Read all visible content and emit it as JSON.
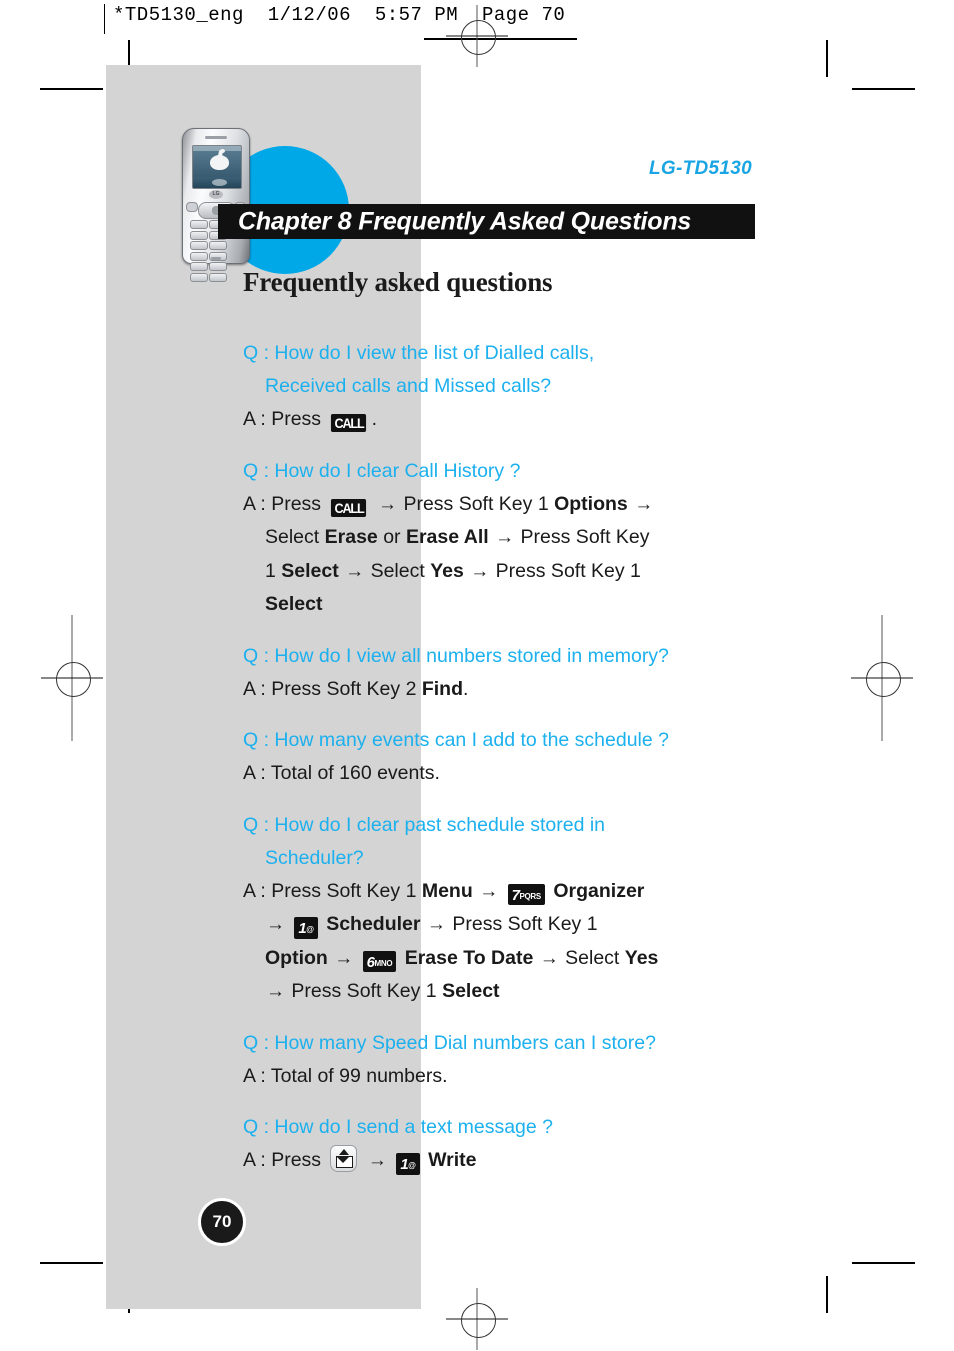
{
  "print_header": {
    "text": "*TD5130_eng  1/12/06  5:57 PM  Page 70"
  },
  "header": {
    "model": "LG-TD5130",
    "chapter_banner": "Chapter 8 Frequently Asked Questions",
    "page_title": "Frequently asked questions"
  },
  "colors": {
    "accent_blue": "#1cb0ee",
    "model_blue": "#19a5e3",
    "wave_blue": "#00a8e8",
    "banner_black": "#111111",
    "panel_gray": "#d4d4d4"
  },
  "keys": {
    "call": "CALL",
    "seven": {
      "digit": "7",
      "letters": "PQRS"
    },
    "six": {
      "digit": "6",
      "letters": "MNO"
    },
    "one": {
      "digit": "1",
      "letters": "@"
    },
    "message": "message-key"
  },
  "faq": [
    {
      "q_label": "Q : ",
      "q_line1": "How do I view the list of Dialled calls,",
      "q_line2": "Received calls and Missed calls?",
      "a_label": "A : ",
      "a_text_1": "Press",
      "a_text_2": "."
    },
    {
      "q_label": "Q : ",
      "q_line1": "How do I clear Call History ?",
      "a_label": "A : ",
      "a_1": "Press",
      "a_2": "Press Soft Key 1",
      "a_3": "Options",
      "a_4": "Select",
      "a_5": "Erase",
      "a_6": "or",
      "a_7": "Erase All",
      "a_8": "Press Soft Key",
      "a_9": "1",
      "a_10": "Select",
      "a_11": "Select",
      "a_12": "Yes",
      "a_13": "Press Soft Key 1",
      "a_14": "Select"
    },
    {
      "q_label": "Q : ",
      "q_line1": "How do I view all numbers stored in memory?",
      "a_label": "A : ",
      "a_1": "Press Soft Key 2",
      "a_2": "Find",
      "a_3": "."
    },
    {
      "q_label": "Q : ",
      "q_line1": "How many events can I add to the schedule ?",
      "a_label": "A : ",
      "a_1": "Total of 160 events."
    },
    {
      "q_label": "Q : ",
      "q_line1": "How do I clear past schedule stored in",
      "q_line2": "Scheduler?",
      "a_label": "A : ",
      "a_1": "Press Soft Key 1",
      "a_2": "Menu",
      "a_3": "Organizer",
      "a_4": "Scheduler",
      "a_5": "Press Soft Key 1",
      "a_6": "Option",
      "a_7": "Erase To Date",
      "a_8": "Select",
      "a_9": "Yes",
      "a_10": "Press Soft Key 1",
      "a_11": "Select"
    },
    {
      "q_label": "Q : ",
      "q_line1": "How many Speed Dial numbers can I store?",
      "a_label": "A : ",
      "a_1": "Total of 99 numbers."
    },
    {
      "q_label": "Q : ",
      "q_line1": "How do I send a text message ?",
      "a_label": "A : ",
      "a_1": "Press",
      "a_2": "Write"
    }
  ],
  "arrow": "→",
  "page_number": "70"
}
